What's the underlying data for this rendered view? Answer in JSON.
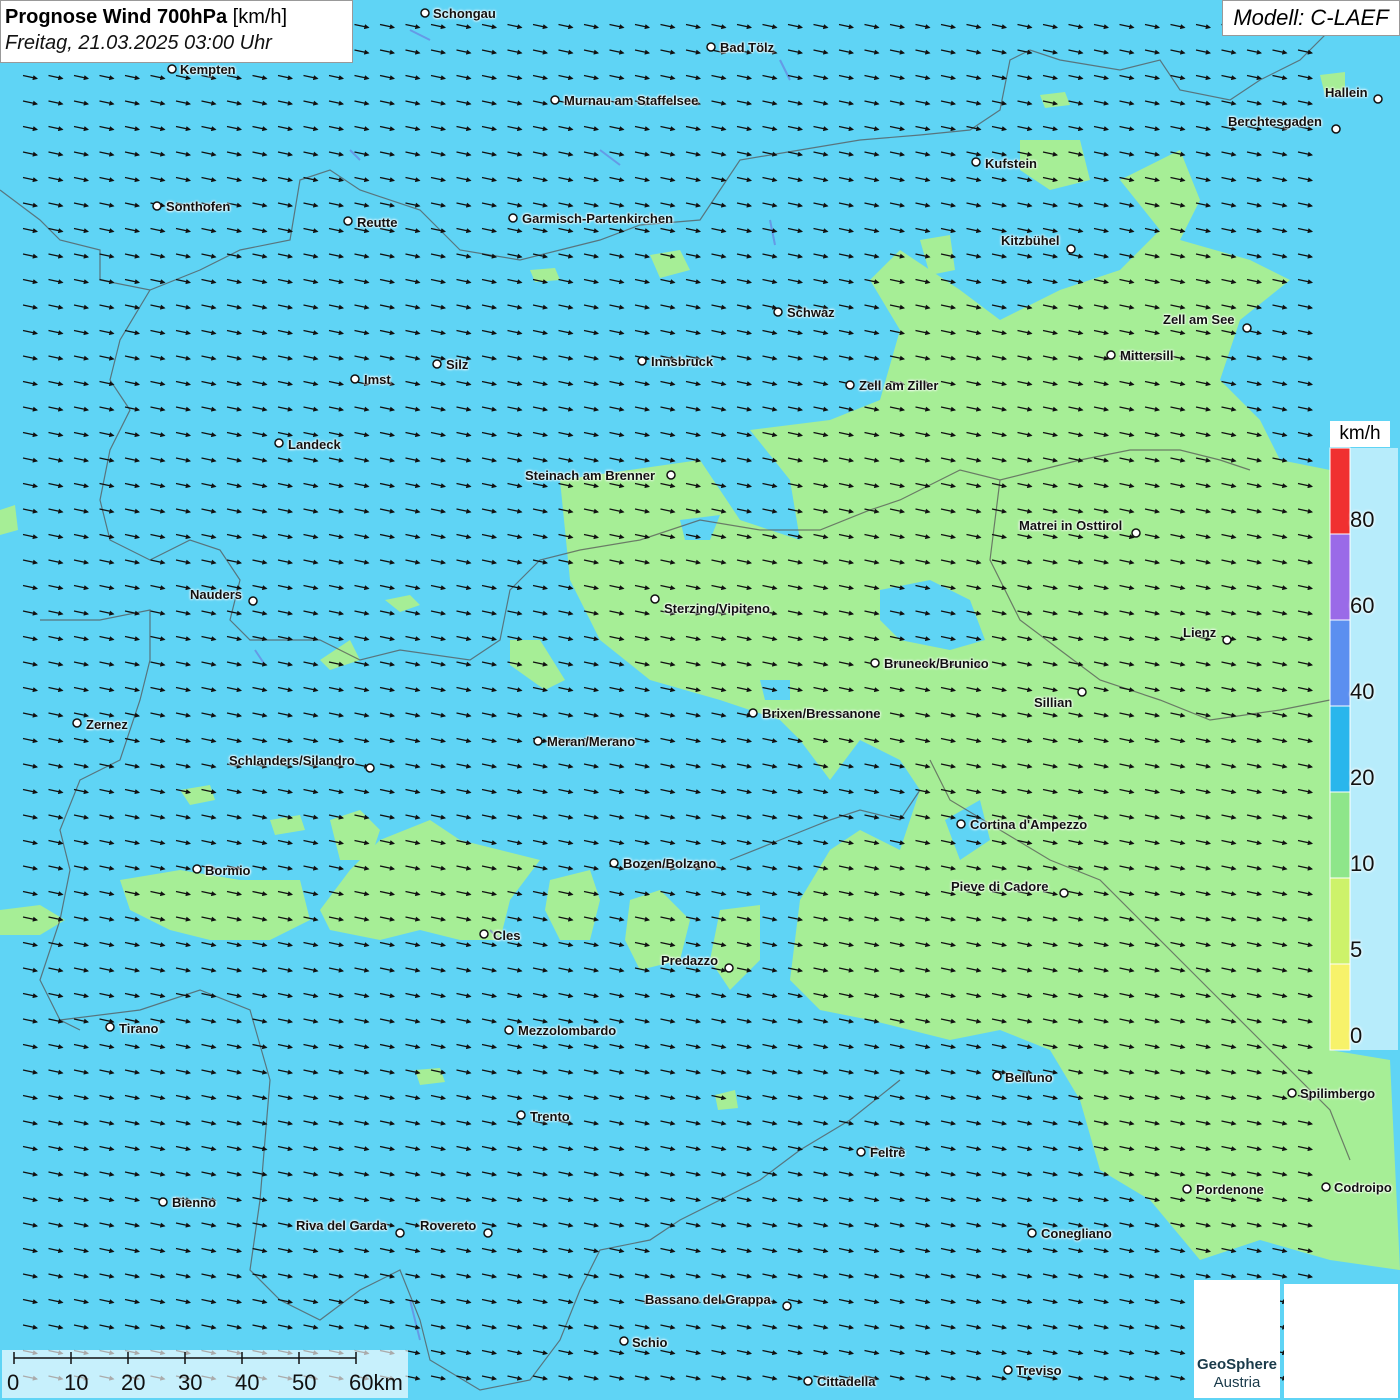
{
  "header": {
    "title_bold": "Prognose Wind 700hPa",
    "title_unit": "[km/h]",
    "subtitle": "Freitag, 21.03.2025 03:00 Uhr",
    "model": "Modell: C-LAEF"
  },
  "legend": {
    "unit": "km/h",
    "labels": [
      "80",
      "60",
      "40",
      "20",
      "10",
      "5",
      "0"
    ],
    "colors": [
      "#f03030",
      "#9a6ae8",
      "#5b8ff0",
      "#29b6ec",
      "#8ee68a",
      "#cdf26a",
      "#f7f26a"
    ]
  },
  "colors": {
    "wind_10_20": "#5fd4f5",
    "wind_5_10": "#a6ee96",
    "arrow": "#111111"
  },
  "scalebar": {
    "ticks": [
      "0",
      "10",
      "20",
      "30",
      "40",
      "50",
      "60km"
    ]
  },
  "logos": {
    "geosphere_line1": "GeoSphere",
    "geosphere_line2": "Austria",
    "geosphere_icon": "geosphere-logo-icon",
    "second_icon": "cloud-arrow-logo-icon"
  },
  "wind_direction": "west-northwest to east-southeast",
  "cities": [
    {
      "name": "Schongau"
    },
    {
      "name": "Bad Tölz"
    },
    {
      "name": "Kempten"
    },
    {
      "name": "Murnau am Staffelsee"
    },
    {
      "name": "Hallein"
    },
    {
      "name": "Berchtesgaden"
    },
    {
      "name": "Kufstein"
    },
    {
      "name": "Sonthofen"
    },
    {
      "name": "Reutte"
    },
    {
      "name": "Garmisch-Partenkirchen"
    },
    {
      "name": "Kitzbühel"
    },
    {
      "name": "Schwaz"
    },
    {
      "name": "Zell am See"
    },
    {
      "name": "Mittersill"
    },
    {
      "name": "Innsbruck"
    },
    {
      "name": "Silz"
    },
    {
      "name": "Imst"
    },
    {
      "name": "Zell am Ziller"
    },
    {
      "name": "Landeck"
    },
    {
      "name": "Steinach am Brenner"
    },
    {
      "name": "Matrei in Osttirol"
    },
    {
      "name": "Nauders"
    },
    {
      "name": "Sterzing/Vipiteno"
    },
    {
      "name": "Lienz"
    },
    {
      "name": "Bruneck/Brunico"
    },
    {
      "name": "Sillian"
    },
    {
      "name": "Brixen/Bressanone"
    },
    {
      "name": "Zernez"
    },
    {
      "name": "Meran/Merano"
    },
    {
      "name": "Schlanders/Silandro"
    },
    {
      "name": "Cortina d'Ampezzo"
    },
    {
      "name": "Bozen/Bolzano"
    },
    {
      "name": "Bormio"
    },
    {
      "name": "Pieve di Cadore"
    },
    {
      "name": "Cles"
    },
    {
      "name": "Predazzo"
    },
    {
      "name": "Tirano"
    },
    {
      "name": "Mezzolombardo"
    },
    {
      "name": "Belluno"
    },
    {
      "name": "Spilimbergo"
    },
    {
      "name": "Trento"
    },
    {
      "name": "Feltre"
    },
    {
      "name": "Pordenone"
    },
    {
      "name": "Codroipo"
    },
    {
      "name": "Bienno"
    },
    {
      "name": "Riva del Garda"
    },
    {
      "name": "Rovereto"
    },
    {
      "name": "Conegliano"
    },
    {
      "name": "Bassano del Grappa"
    },
    {
      "name": "Schio"
    },
    {
      "name": "Treviso"
    },
    {
      "name": "Cittadella"
    }
  ]
}
